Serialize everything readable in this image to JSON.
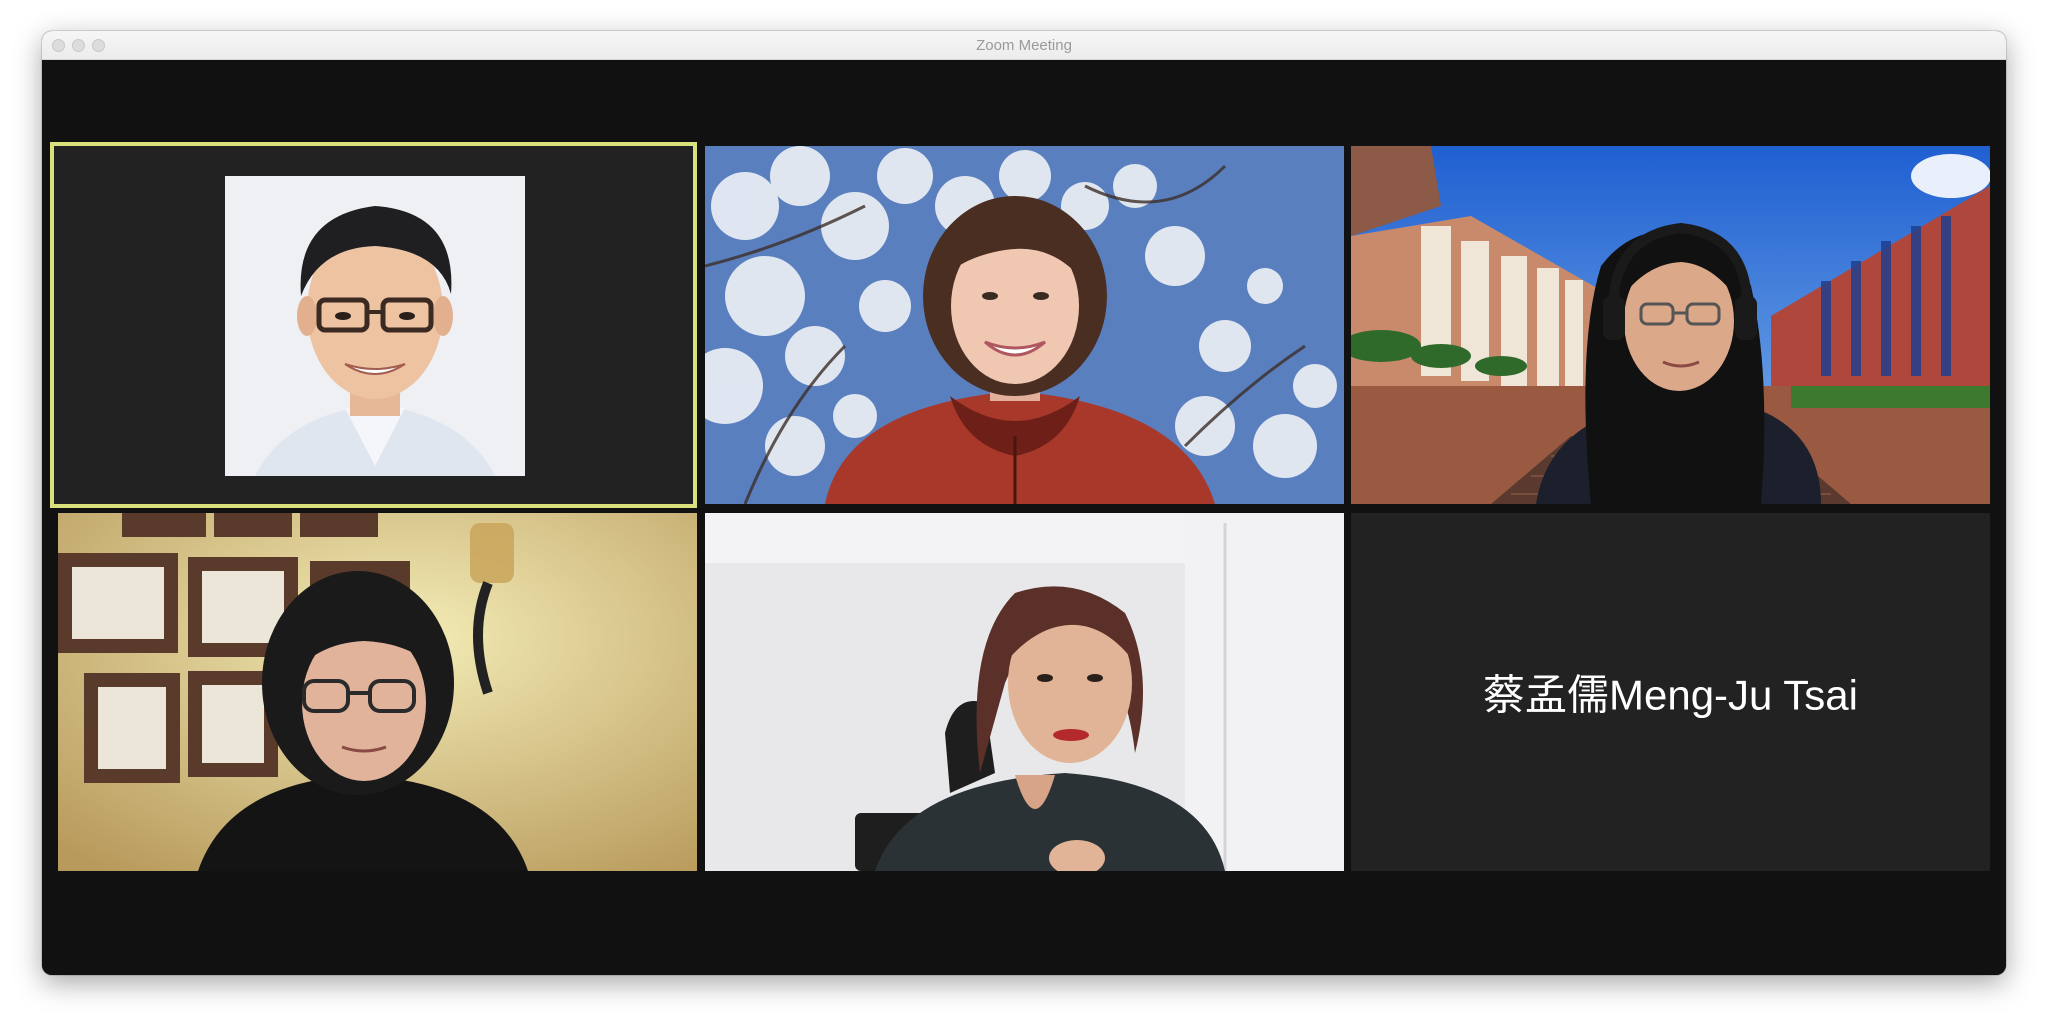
{
  "window": {
    "title": "Zoom Meeting"
  },
  "participants": [
    {
      "name": "",
      "type": "profile-photo",
      "active_speaker": true
    },
    {
      "name": "",
      "type": "video"
    },
    {
      "name": "",
      "type": "video"
    },
    {
      "name": "",
      "type": "video"
    },
    {
      "name": "",
      "type": "video"
    },
    {
      "name": "蔡孟儒Meng-Ju Tsai",
      "type": "name-only"
    }
  ],
  "colors": {
    "active_speaker_border": "#d9e07c",
    "stage_background": "#111111",
    "tile_background": "#222222"
  }
}
